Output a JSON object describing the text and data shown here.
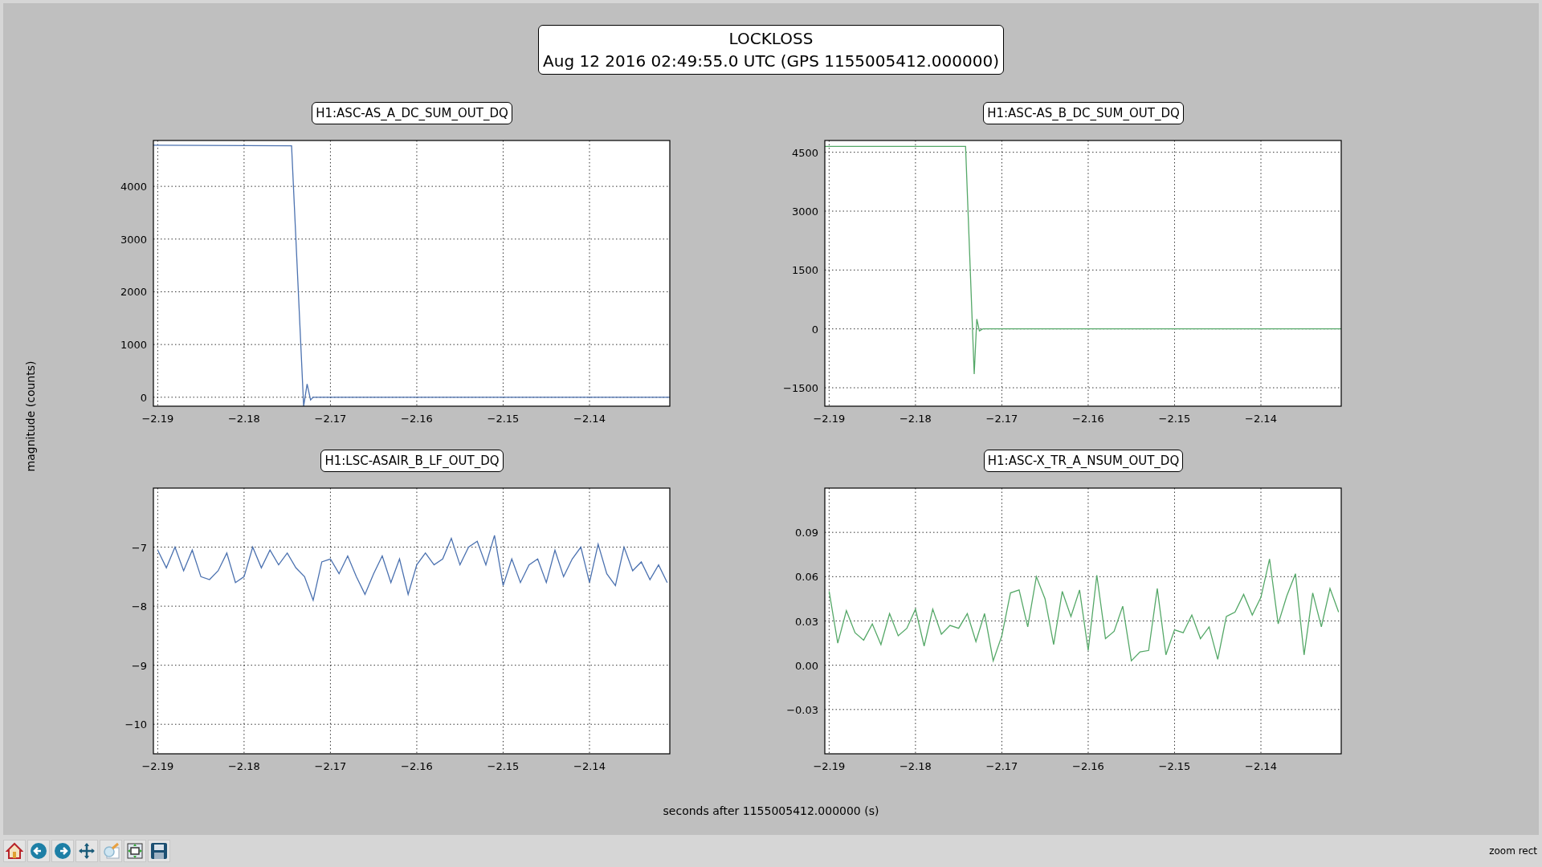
{
  "figure": {
    "title_lines": [
      "LOCKLOSS",
      "Aug 12 2016 02:49:55.0 UTC (GPS 1155005412.000000)"
    ],
    "ylabel": "magnitude (counts)",
    "xlabel": "seconds after 1155005412.000000 (s)",
    "subplots": [
      {
        "chart_data": {
          "type": "line",
          "title": "H1:ASC-AS_A_DC_SUM_OUT_DQ",
          "xlim": [
            -2.1905,
            -2.1307
          ],
          "ylim": [
            -170,
            4870
          ],
          "xticks": [
            {
              "value": -2.19,
              "label": "−2.19"
            },
            {
              "value": -2.18,
              "label": "−2.18"
            },
            {
              "value": -2.17,
              "label": "−2.17"
            },
            {
              "value": -2.16,
              "label": "−2.16"
            },
            {
              "value": -2.15,
              "label": "−2.15"
            },
            {
              "value": -2.14,
              "label": "−2.14"
            }
          ],
          "yticks": [
            0,
            1000,
            2000,
            3000,
            4000
          ],
          "x": [
            -2.1905,
            -2.1745,
            -2.1731,
            -2.1727,
            -2.1723,
            -2.172,
            -2.1307
          ],
          "series": [
            {
              "color": "#4c72b0",
              "values": [
                4780,
                4770,
                -170,
                250,
                -50,
                0,
                0
              ]
            }
          ],
          "grid": true
        }
      },
      {
        "chart_data": {
          "type": "line",
          "title": "H1:ASC-AS_B_DC_SUM_OUT_DQ",
          "xlim": [
            -2.1905,
            -2.1307
          ],
          "ylim": [
            -1970,
            4800
          ],
          "xticks": [
            {
              "value": -2.19,
              "label": "−2.19"
            },
            {
              "value": -2.18,
              "label": "−2.18"
            },
            {
              "value": -2.17,
              "label": "−2.17"
            },
            {
              "value": -2.16,
              "label": "−2.16"
            },
            {
              "value": -2.15,
              "label": "−2.15"
            },
            {
              "value": -2.14,
              "label": "−2.14"
            }
          ],
          "yticks": [
            {
              "value": -1500,
              "label": "−1500"
            },
            0,
            1500,
            3000,
            4500
          ],
          "x": [
            -2.1905,
            -2.1742,
            -2.1732,
            -2.1729,
            -2.1726,
            -2.1722,
            -2.1307
          ],
          "series": [
            {
              "color": "#55a868",
              "values": [
                4650,
                4650,
                -1150,
                250,
                -50,
                0,
                0
              ]
            }
          ],
          "grid": true
        }
      },
      {
        "chart_data": {
          "type": "line",
          "title": "H1:LSC-ASAIR_B_LF_OUT_DQ",
          "xlim": [
            -2.1905,
            -2.1307
          ],
          "ylim": [
            -10.5,
            -6
          ],
          "xticks": [
            {
              "value": -2.19,
              "label": "−2.19"
            },
            {
              "value": -2.18,
              "label": "−2.18"
            },
            {
              "value": -2.17,
              "label": "−2.17"
            },
            {
              "value": -2.16,
              "label": "−2.16"
            },
            {
              "value": -2.15,
              "label": "−2.15"
            },
            {
              "value": -2.14,
              "label": "−2.14"
            }
          ],
          "yticks": [
            {
              "value": -10,
              "label": "−10"
            },
            {
              "value": -9,
              "label": "−9"
            },
            {
              "value": -8,
              "label": "−8"
            },
            {
              "value": -7,
              "label": "−7"
            }
          ],
          "x": [
            -2.19,
            -2.189,
            -2.188,
            -2.187,
            -2.186,
            -2.185,
            -2.184,
            -2.183,
            -2.182,
            -2.181,
            -2.18,
            -2.179,
            -2.178,
            -2.177,
            -2.176,
            -2.175,
            -2.174,
            -2.173,
            -2.172,
            -2.171,
            -2.17,
            -2.169,
            -2.168,
            -2.167,
            -2.166,
            -2.165,
            -2.164,
            -2.163,
            -2.162,
            -2.161,
            -2.16,
            -2.159,
            -2.158,
            -2.157,
            -2.156,
            -2.155,
            -2.154,
            -2.153,
            -2.152,
            -2.151,
            -2.15,
            -2.149,
            -2.148,
            -2.147,
            -2.146,
            -2.145,
            -2.144,
            -2.143,
            -2.142,
            -2.141,
            -2.14,
            -2.139,
            -2.138,
            -2.137,
            -2.136,
            -2.135,
            -2.134,
            -2.133,
            -2.132,
            -2.131
          ],
          "series": [
            {
              "color": "#4c72b0",
              "values": [
                -7.05,
                -7.35,
                -7.0,
                -7.4,
                -7.05,
                -7.5,
                -7.55,
                -7.4,
                -7.1,
                -7.6,
                -7.5,
                -7.0,
                -7.35,
                -7.05,
                -7.3,
                -7.1,
                -7.35,
                -7.5,
                -7.9,
                -7.25,
                -7.2,
                -7.45,
                -7.15,
                -7.5,
                -7.8,
                -7.45,
                -7.15,
                -7.6,
                -7.2,
                -7.8,
                -7.3,
                -7.1,
                -7.3,
                -7.2,
                -6.85,
                -7.3,
                -7.0,
                -6.9,
                -7.3,
                -6.8,
                -7.65,
                -7.2,
                -7.6,
                -7.3,
                -7.2,
                -7.6,
                -7.05,
                -7.5,
                -7.2,
                -7.0,
                -7.6,
                -6.95,
                -7.45,
                -7.65,
                -7.0,
                -7.4,
                -7.25,
                -7.55,
                -7.3,
                -7.6
              ]
            }
          ],
          "grid": true
        }
      },
      {
        "chart_data": {
          "type": "line",
          "title": "H1:ASC-X_TR_A_NSUM_OUT_DQ",
          "xlim": [
            -2.1905,
            -2.1307
          ],
          "ylim": [
            -0.06,
            0.12
          ],
          "xticks": [
            {
              "value": -2.19,
              "label": "−2.19"
            },
            {
              "value": -2.18,
              "label": "−2.18"
            },
            {
              "value": -2.17,
              "label": "−2.17"
            },
            {
              "value": -2.16,
              "label": "−2.16"
            },
            {
              "value": -2.15,
              "label": "−2.15"
            },
            {
              "value": -2.14,
              "label": "−2.14"
            }
          ],
          "yticks": [
            {
              "value": -0.03,
              "label": "−0.03"
            },
            {
              "value": 0,
              "label": "0.00"
            },
            {
              "value": 0.03,
              "label": "0.03"
            },
            {
              "value": 0.06,
              "label": "0.06"
            },
            {
              "value": 0.09,
              "label": "0.09"
            }
          ],
          "x": [
            -2.19,
            -2.189,
            -2.188,
            -2.187,
            -2.186,
            -2.185,
            -2.184,
            -2.183,
            -2.182,
            -2.181,
            -2.18,
            -2.179,
            -2.178,
            -2.177,
            -2.176,
            -2.175,
            -2.174,
            -2.173,
            -2.172,
            -2.171,
            -2.17,
            -2.169,
            -2.168,
            -2.167,
            -2.166,
            -2.165,
            -2.164,
            -2.163,
            -2.162,
            -2.161,
            -2.16,
            -2.159,
            -2.158,
            -2.157,
            -2.156,
            -2.155,
            -2.154,
            -2.153,
            -2.152,
            -2.151,
            -2.15,
            -2.149,
            -2.148,
            -2.147,
            -2.146,
            -2.145,
            -2.144,
            -2.143,
            -2.142,
            -2.141,
            -2.14,
            -2.139,
            -2.138,
            -2.137,
            -2.136,
            -2.135,
            -2.134,
            -2.133,
            -2.132,
            -2.131
          ],
          "series": [
            {
              "color": "#55a868",
              "values": [
                0.05,
                0.015,
                0.037,
                0.022,
                0.017,
                0.028,
                0.014,
                0.035,
                0.02,
                0.025,
                0.038,
                0.013,
                0.038,
                0.021,
                0.027,
                0.025,
                0.035,
                0.016,
                0.035,
                0.003,
                0.02,
                0.049,
                0.051,
                0.026,
                0.06,
                0.045,
                0.014,
                0.05,
                0.033,
                0.051,
                0.01,
                0.061,
                0.018,
                0.023,
                0.04,
                0.003,
                0.009,
                0.01,
                0.052,
                0.007,
                0.024,
                0.022,
                0.034,
                0.018,
                0.026,
                0.004,
                0.033,
                0.036,
                0.048,
                0.034,
                0.046,
                0.072,
                0.028,
                0.047,
                0.062,
                0.007,
                0.049,
                0.026,
                0.052,
                0.036
              ]
            }
          ],
          "grid": true
        }
      }
    ]
  },
  "toolbar": {
    "buttons": [
      {
        "kind": "home"
      },
      {
        "kind": "back"
      },
      {
        "kind": "forward"
      },
      {
        "kind": "pan"
      },
      {
        "kind": "zoom"
      },
      {
        "kind": "subplots"
      },
      {
        "kind": "save"
      }
    ],
    "message": "zoom rect"
  }
}
